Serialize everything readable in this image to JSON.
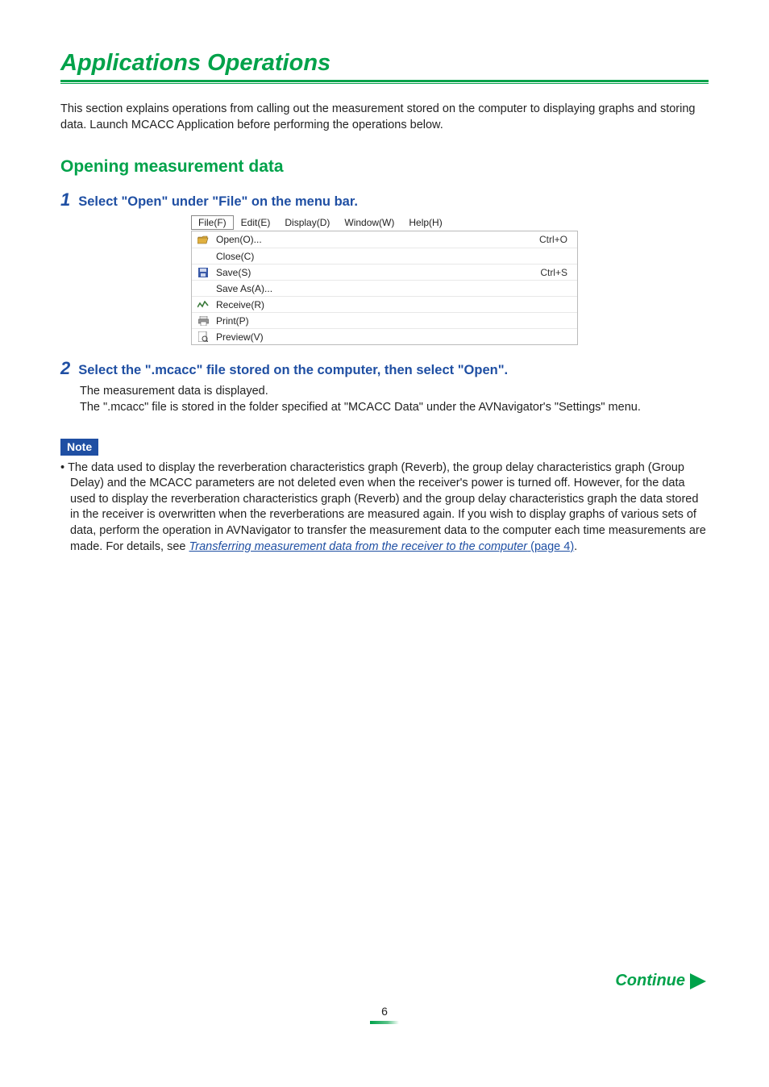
{
  "page": {
    "title": "Applications Operations",
    "intro": "This section explains operations from calling out the measurement stored on the computer to displaying graphs and storing data. Launch MCACC Application before performing the operations below.",
    "number": "6",
    "continue": "Continue"
  },
  "section": {
    "heading": "Opening measurement data"
  },
  "step1": {
    "num": "1",
    "text": "Select \"Open\" under \"File\" on the menu bar."
  },
  "menubar": {
    "file": "File(F)",
    "edit": "Edit(E)",
    "display": "Display(D)",
    "window": "Window(W)",
    "help": "Help(H)"
  },
  "dropdown": [
    {
      "icon": "open-folder-icon",
      "label": "Open(O)...",
      "shortcut": "Ctrl+O"
    },
    {
      "icon": "",
      "label": "Close(C)",
      "shortcut": ""
    },
    {
      "icon": "save-disk-icon",
      "label": "Save(S)",
      "shortcut": "Ctrl+S"
    },
    {
      "icon": "",
      "label": "Save As(A)...",
      "shortcut": ""
    },
    {
      "icon": "receive-wave-icon",
      "label": "Receive(R)",
      "shortcut": ""
    },
    {
      "icon": "print-icon",
      "label": "Print(P)",
      "shortcut": ""
    },
    {
      "icon": "preview-icon",
      "label": "Preview(V)",
      "shortcut": ""
    }
  ],
  "step2": {
    "num": "2",
    "text": "Select the \".mcacc\" file stored on the computer, then select \"Open\".",
    "sub1": "The measurement data is displayed.",
    "sub2": "The \".mcacc\" file is stored in the folder specified at \"MCACC Data\" under the AVNavigator's \"Settings\" menu."
  },
  "note": {
    "label": "Note",
    "bullet": "•",
    "body_pre": "The data used to display the reverberation characteristics graph (Reverb), the group delay characteristics graph (Group Delay) and the MCACC parameters are not deleted even when the receiver's power is turned off. However, for the data used to display the reverberation characteristics graph (Reverb) and the group delay characteristics graph the data stored in the receiver is overwritten when the reverberations are measured again. If you wish to display graphs of various sets of data, perform the operation in AVNavigator to transfer the measurement data to the computer each time measurements are made. For details, see ",
    "link_text": "Transferring measurement data from the receiver to the computer",
    "link_page": " (page 4)",
    "body_post": "."
  }
}
